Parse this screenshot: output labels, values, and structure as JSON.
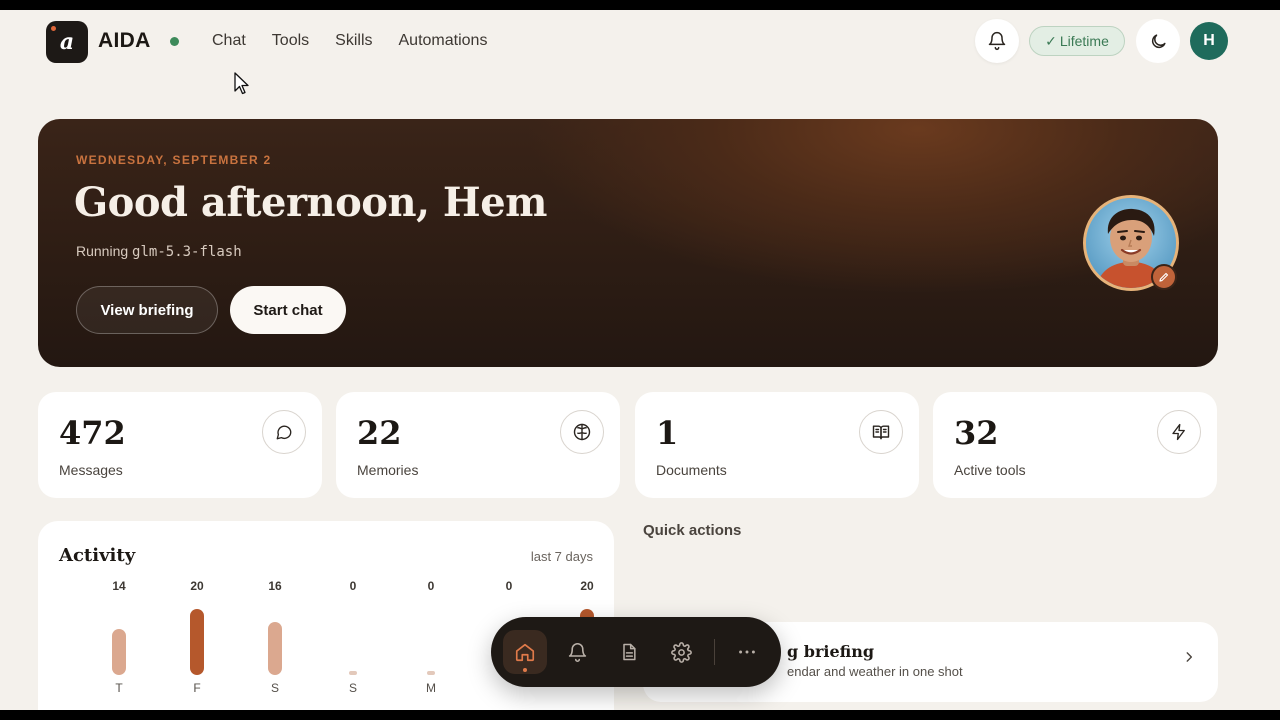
{
  "app": {
    "logo_letter": "a",
    "name": "AIDA",
    "status_color": "#3d8a5a"
  },
  "nav": {
    "items": [
      "Chat",
      "Tools",
      "Skills",
      "Automations"
    ]
  },
  "header": {
    "notifications_icon": "bell-icon",
    "plan_badge": "Lifetime",
    "theme_icon": "moon-icon",
    "user_initial": "H"
  },
  "hero": {
    "date": "WEDNESDAY, SEPTEMBER 2",
    "greeting": "Good afternoon, Hem",
    "running_prefix": "Running ",
    "model": "glm-5.3-flash",
    "view_briefing": "View briefing",
    "start_chat": "Start chat"
  },
  "stats": [
    {
      "value": "472",
      "label": "Messages",
      "icon": "chat-bubble-icon"
    },
    {
      "value": "22",
      "label": "Memories",
      "icon": "brain-icon"
    },
    {
      "value": "1",
      "label": "Documents",
      "icon": "book-icon"
    },
    {
      "value": "32",
      "label": "Active tools",
      "icon": "lightning-icon"
    }
  ],
  "activity": {
    "title": "Activity",
    "range": "last 7 days",
    "chart_data": {
      "type": "bar",
      "categories": [
        "T",
        "F",
        "S",
        "S",
        "M",
        "",
        ""
      ],
      "values": [
        14,
        20,
        16,
        0,
        0,
        0,
        20
      ],
      "colors": {
        "max": "#b5582c",
        "normal": "#dba88f",
        "zero": "#e3c9bb"
      }
    }
  },
  "quick_actions": {
    "title": "Quick actions",
    "items": [
      {
        "title_visible": "g briefing",
        "desc_visible": "endar and weather in one shot"
      }
    ]
  },
  "dock": {
    "items": [
      "home-icon",
      "bell-icon",
      "document-icon",
      "gear-icon",
      "more-icon"
    ],
    "active_color": "#e07a4a"
  }
}
